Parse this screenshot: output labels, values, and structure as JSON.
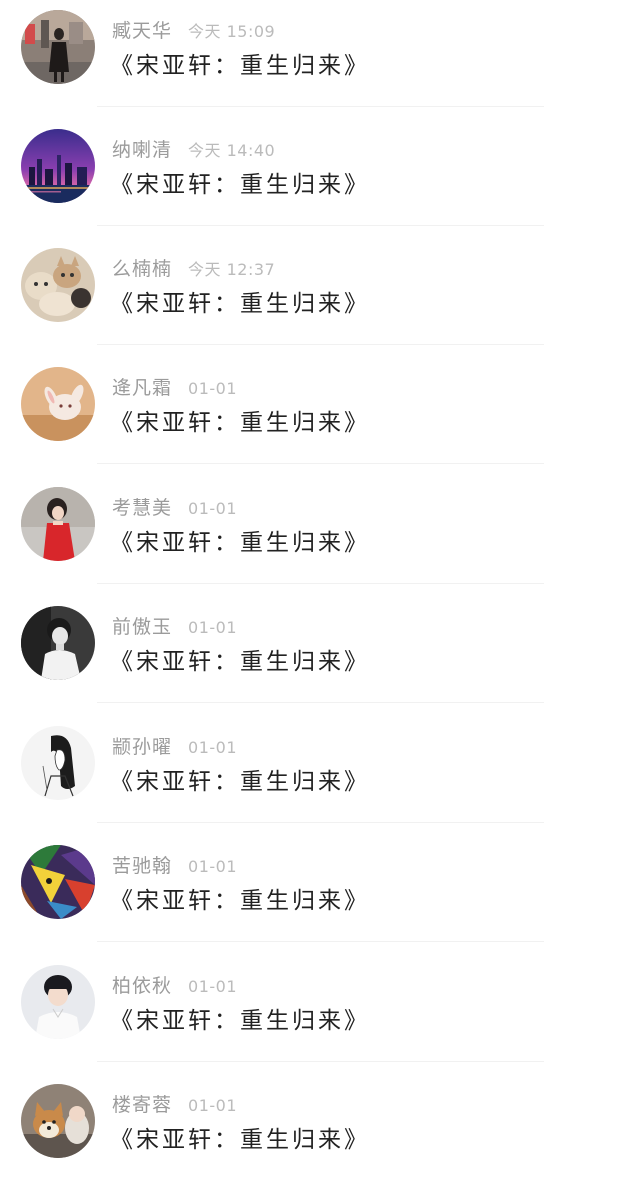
{
  "messages": [
    {
      "name": "臧天华",
      "time": "今天 15:09",
      "title": "《宋亚轩：重生归来》",
      "avatar": "street-photo"
    },
    {
      "name": "纳喇清",
      "time": "今天 14:40",
      "title": "《宋亚轩：重生归来》",
      "avatar": "city-night"
    },
    {
      "name": "么楠楠",
      "time": "今天 12:37",
      "title": "《宋亚轩：重生归来》",
      "avatar": "cats"
    },
    {
      "name": "逄凡霜",
      "time": "01-01",
      "title": "《宋亚轩：重生归来》",
      "avatar": "rabbit-in-box"
    },
    {
      "name": "考慧美",
      "time": "01-01",
      "title": "《宋亚轩：重生归来》",
      "avatar": "girl-red-dress"
    },
    {
      "name": "前傲玉",
      "time": "01-01",
      "title": "《宋亚轩：重生归来》",
      "avatar": "bw-boy"
    },
    {
      "name": "颛孙曜",
      "time": "01-01",
      "title": "《宋亚轩：重生归来》",
      "avatar": "sketch-girl"
    },
    {
      "name": "苦驰翰",
      "time": "01-01",
      "title": "《宋亚轩：重生归来》",
      "avatar": "colorful-art"
    },
    {
      "name": "柏依秋",
      "time": "01-01",
      "title": "《宋亚轩：重生归来》",
      "avatar": "boy-portrait"
    },
    {
      "name": "楼寄蓉",
      "time": "01-01",
      "title": "《宋亚轩：重生归来》",
      "avatar": "shiba-dog"
    }
  ]
}
